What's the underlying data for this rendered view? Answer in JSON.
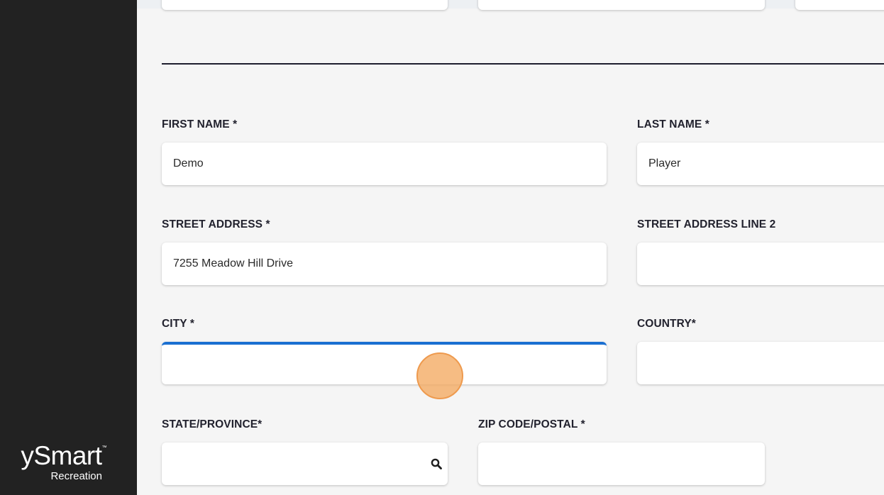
{
  "brand": {
    "logo_text": "ySmart",
    "trademark": "™",
    "subtitle": "Recreation"
  },
  "form": {
    "first_name": {
      "label": "FIRST NAME *",
      "value": "Demo"
    },
    "last_name": {
      "label": "LAST NAME *",
      "value": "Player"
    },
    "street_address": {
      "label": "STREET ADDRESS *",
      "value": "7255 Meadow Hill Drive"
    },
    "street_address_2": {
      "label": "STREET ADDRESS LINE 2",
      "value": ""
    },
    "city": {
      "label": "CITY *",
      "value": ""
    },
    "country": {
      "label": "COUNTRY*",
      "value": ""
    },
    "state": {
      "label": "STATE/PROVINCE*",
      "value": ""
    },
    "zip": {
      "label": "ZIP CODE/POSTAL *",
      "value": ""
    }
  },
  "icons": {
    "state_search": "search-icon"
  },
  "colors": {
    "focus_accent": "#1a6fd1",
    "sidebar": "#222222",
    "click_indicator": "#f4a960"
  }
}
